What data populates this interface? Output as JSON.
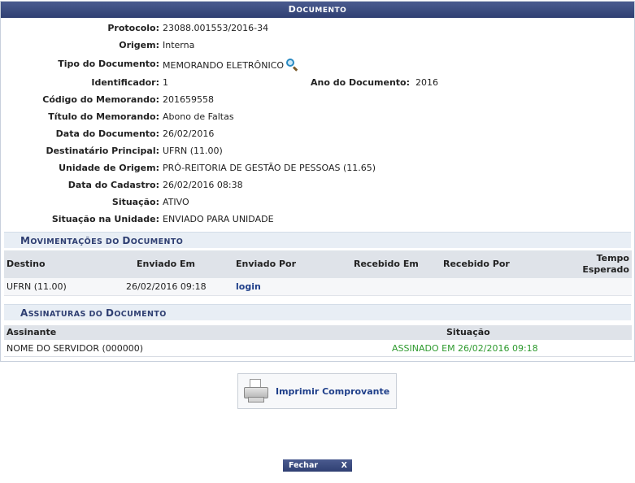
{
  "panel": {
    "title_first": "D",
    "title_rest": "OCUMENTO"
  },
  "fields": [
    {
      "label": "Protocolo:",
      "value": "23088.001553/2016-34"
    },
    {
      "label": "Origem:",
      "value": "Interna"
    },
    {
      "label": "Tipo do Documento:",
      "value": "MEMORANDO ELETRÔNICO"
    },
    {
      "label": "Identificador:",
      "value": "1"
    },
    {
      "label": "Código do Memorando:",
      "value": "201659558"
    },
    {
      "label": "Título do Memorando:",
      "value": "Abono de Faltas"
    },
    {
      "label": "Data do Documento:",
      "value": "26/02/2016"
    },
    {
      "label": "Destinatário Principal:",
      "value": "UFRN (11.00)"
    },
    {
      "label": "Unidade de Origem:",
      "value": "PRÓ-REITORIA DE GESTÃO DE PESSOAS (11.65)"
    },
    {
      "label": "Data do Cadastro:",
      "value": "26/02/2016 08:38"
    },
    {
      "label": "Situação:",
      "value": "ATIVO"
    },
    {
      "label": "Situação na Unidade:",
      "value": "ENVIADO PARA UNIDADE"
    }
  ],
  "ano": {
    "label": "Ano do Documento:",
    "value": "2016"
  },
  "movimentacoes": {
    "title_first": "M",
    "title_rest": "OVIMENTAÇÕES DO ",
    "title_first2": "D",
    "title_rest2": "OCUMENTO",
    "headers": {
      "destino": "Destino",
      "enviado_em": "Enviado Em",
      "enviado_por": "Enviado Por",
      "recebido_em": "Recebido Em",
      "recebido_por": "Recebido Por",
      "tempo_line1": "Tempo",
      "tempo_line2": "Esperado"
    },
    "rows": [
      {
        "destino": "UFRN (11.00)",
        "enviado_em": "26/02/2016 09:18",
        "enviado_por": "login",
        "recebido_em": "",
        "recebido_por": "",
        "tempo": ""
      }
    ]
  },
  "assinaturas": {
    "title_first": "A",
    "title_rest": "SSINATURAS DO ",
    "title_first2": "D",
    "title_rest2": "OCUMENTO",
    "headers": {
      "assinante": "Assinante",
      "situacao": "Situação"
    },
    "rows": [
      {
        "assinante": "NOME DO SERVIDOR (000000)",
        "situacao": "ASSINADO EM 26/02/2016 09:18"
      }
    ]
  },
  "actions": {
    "print_label": "Imprimir Comprovante",
    "close_label": "Fechar",
    "close_x": "X"
  },
  "colors": {
    "header_bg": "#2f3f72",
    "section_bg": "#e8eef5",
    "link": "#1f3f8a",
    "signed": "#2e9a2e"
  }
}
